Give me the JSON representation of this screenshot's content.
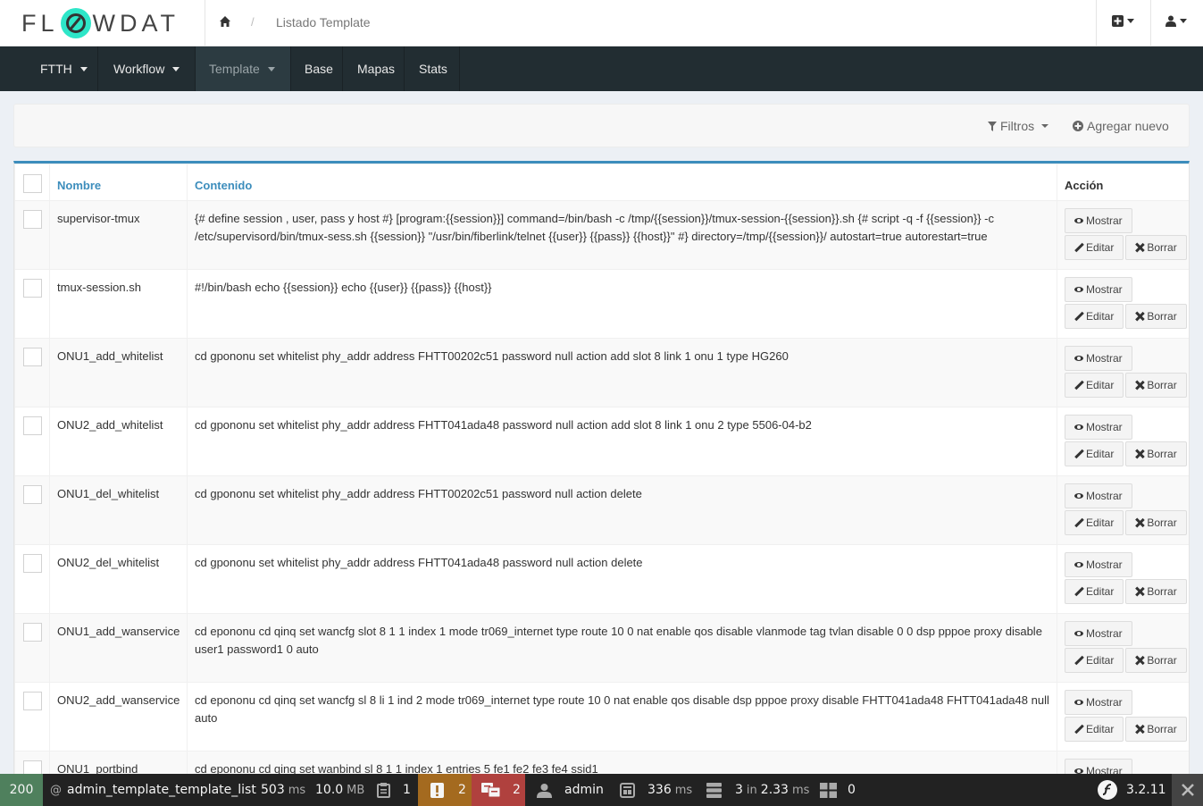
{
  "header": {
    "logo_text_left": "FL",
    "logo_text_right": "WDAT",
    "breadcrumb": "Listado Template"
  },
  "nav": {
    "items": [
      {
        "label": "FTTH",
        "dropdown": true
      },
      {
        "label": "Workflow",
        "dropdown": true
      },
      {
        "label": "Template",
        "dropdown": true,
        "active": true
      },
      {
        "label": "Base",
        "dropdown": false
      },
      {
        "label": "Mapas",
        "dropdown": false
      },
      {
        "label": "Stats",
        "dropdown": false
      }
    ]
  },
  "filters": {
    "filters_label": "Filtros",
    "add_label": "Agregar nuevo"
  },
  "table": {
    "columns": [
      "Nombre",
      "Contenido",
      "Acción"
    ],
    "actions": {
      "show": "Mostrar",
      "edit": "Editar",
      "delete": "Borrar"
    },
    "rows": [
      {
        "name": "supervisor-tmux",
        "content": "{# define session , user, pass y host #} [program:{{session}}] command=/bin/bash -c /tmp/{{session}}/tmux-session-{{session}}.sh {# script -q -f {{session}} -c /etc/supervisord/bin/tmux-sess.sh {{session}} \"/usr/bin/fiberlink/telnet {{user}} {{pass}} {{host}}\" #} directory=/tmp/{{session}}/ autostart=true autorestart=true"
      },
      {
        "name": "tmux-session.sh",
        "content": "#!/bin/bash echo {{session}} echo {{user}} {{pass}} {{host}}"
      },
      {
        "name": "ONU1_add_whitelist",
        "content": "cd gpononu set whitelist phy_addr address FHTT00202c51 password null action add slot 8 link 1 onu 1 type HG260"
      },
      {
        "name": "ONU2_add_whitelist",
        "content": "cd gpononu set whitelist phy_addr address FHTT041ada48 password null action add slot 8 link 1 onu 2 type 5506-04-b2"
      },
      {
        "name": "ONU1_del_whitelist",
        "content": "cd gpononu set whitelist phy_addr address FHTT00202c51 password null action delete"
      },
      {
        "name": "ONU2_del_whitelist",
        "content": "cd gpononu set whitelist phy_addr address FHTT041ada48 password null action delete"
      },
      {
        "name": "ONU1_add_wanservice",
        "content": "cd epononu cd qinq set wancfg slot 8 1 1 index 1 mode tr069_internet type route 10 0 nat enable qos disable vlanmode tag tvlan disable 0 0 dsp pppoe proxy disable user1 password1 0 auto"
      },
      {
        "name": "ONU2_add_wanservice",
        "content": "cd epononu cd qinq set wancfg sl 8 li 1 ind 2 mode tr069_internet type route 10 0 nat enable qos disable dsp pppoe proxy disable FHTT041ada48 FHTT041ada48 null auto"
      },
      {
        "name": "ONU1_portbind",
        "content": "cd epononu cd qinq set wanbind sl 8 1 1 index 1 entries 5 fe1 fe2 fe3 fe4 ssid1"
      }
    ]
  },
  "toolbar": {
    "status_code": "200",
    "route": "admin_template_template_list",
    "time_value": "503",
    "time_unit": "ms",
    "memory_value": "10.0",
    "memory_unit": "MB",
    "forms_count": "1",
    "logs_count": "2",
    "translation_count": "2",
    "user": "admin",
    "twig_value": "336",
    "twig_unit": "ms",
    "db_queries": "3",
    "db_in": "in",
    "db_time": "2.33",
    "db_unit": "ms",
    "cache_count": "0",
    "symfony_version": "3.2.11"
  },
  "colors": {
    "accent": "#3c8dbc",
    "nav_bg": "#222d32",
    "status_ok": "#4f805d",
    "warn": "#a46a1f",
    "error": "#b0413e"
  }
}
